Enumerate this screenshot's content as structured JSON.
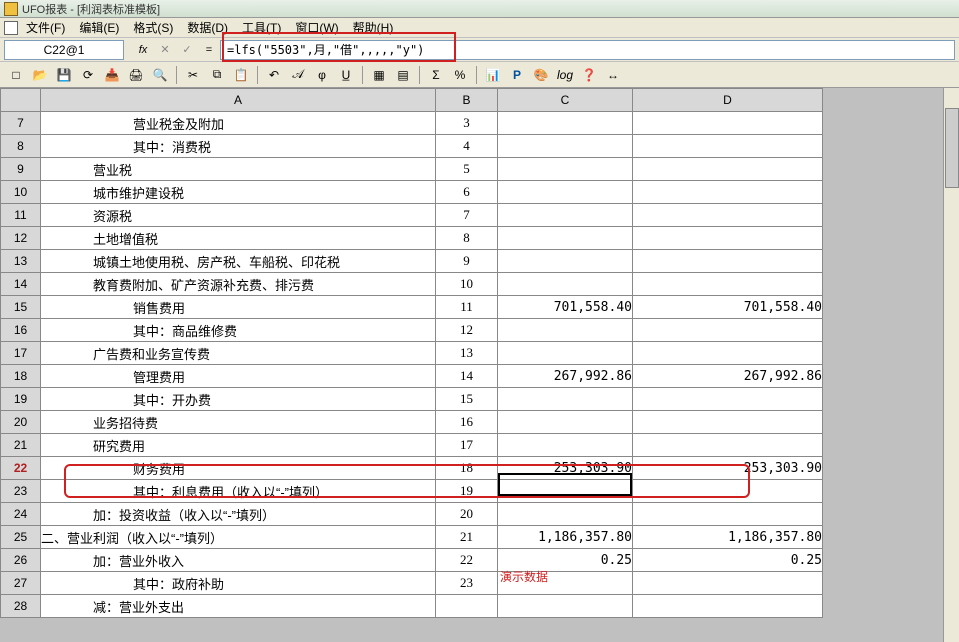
{
  "title": "UFO报表 - [利润表标准模板]",
  "menu": {
    "file": "文件(F)",
    "edit": "编辑(E)",
    "format": "格式(S)",
    "data": "数据(D)",
    "tool": "工具(T)",
    "window": "窗口(W)",
    "help": "帮助(H)"
  },
  "cell_ref": "C22@1",
  "formula": "=lfs(\"5503\",月,\"借\",,,,,\"y\")",
  "fb": {
    "fx": "fx",
    "x": "✕",
    "check": "✓",
    "eq": "="
  },
  "tb": {
    "new": "□",
    "open": "📂",
    "save": "💾",
    "refresh": "⟳",
    "import": "📥",
    "print": "🖨",
    "preview": "🔍",
    "cut": "✂",
    "copy": "⧉",
    "paste": "📋",
    "undo": "↶",
    "script": "𝒜",
    "phi": "φ",
    "ul": "U̲",
    "grid1": "▦",
    "grid2": "▤",
    "sigma": "Σ",
    "pct": "%",
    "chart": "📊",
    "bold": "P",
    "color": "🎨",
    "log": "log",
    "help": "❓",
    "arrow": "↔"
  },
  "cols": {
    "a": "A",
    "b": "B",
    "c": "C",
    "d": "D"
  },
  "rows": [
    {
      "n": 7,
      "a": "营业税金及附加",
      "cls": "indent2",
      "b": "3",
      "c": "",
      "d": ""
    },
    {
      "n": 8,
      "a": "其中：消费税",
      "cls": "indent2",
      "b": "4",
      "c": "",
      "d": ""
    },
    {
      "n": 9,
      "a": "营业税",
      "cls": "indent3",
      "b": "5",
      "c": "",
      "d": ""
    },
    {
      "n": 10,
      "a": "城市维护建设税",
      "cls": "indent3",
      "b": "6",
      "c": "",
      "d": ""
    },
    {
      "n": 11,
      "a": "资源税",
      "cls": "indent3",
      "b": "7",
      "c": "",
      "d": ""
    },
    {
      "n": 12,
      "a": "土地增值税",
      "cls": "indent3",
      "b": "8",
      "c": "",
      "d": ""
    },
    {
      "n": 13,
      "a": "城镇土地使用税、房产税、车船税、印花税",
      "cls": "indent3",
      "b": "9",
      "c": "",
      "d": ""
    },
    {
      "n": 14,
      "a": "教育费附加、矿产资源补充费、排污费",
      "cls": "indent3",
      "b": "10",
      "c": "",
      "d": ""
    },
    {
      "n": 15,
      "a": "销售费用",
      "cls": "indent2",
      "b": "11",
      "c": "701,558.40",
      "d": "701,558.40"
    },
    {
      "n": 16,
      "a": "其中：商品维修费",
      "cls": "indent2",
      "b": "12",
      "c": "",
      "d": ""
    },
    {
      "n": 17,
      "a": "广告费和业务宣传费",
      "cls": "indent3",
      "b": "13",
      "c": "",
      "d": ""
    },
    {
      "n": 18,
      "a": "管理费用",
      "cls": "indent2",
      "b": "14",
      "c": "267,992.86",
      "d": "267,992.86"
    },
    {
      "n": 19,
      "a": "其中：开办费",
      "cls": "indent2",
      "b": "15",
      "c": "",
      "d": ""
    },
    {
      "n": 20,
      "a": "业务招待费",
      "cls": "indent3",
      "b": "16",
      "c": "",
      "d": ""
    },
    {
      "n": 21,
      "a": "研究费用",
      "cls": "indent3",
      "b": "17",
      "c": "",
      "d": ""
    },
    {
      "n": 22,
      "a": "财务费用",
      "cls": "indent2",
      "b": "18",
      "c": "253,303.90",
      "d": "253,303.90",
      "sel": true
    },
    {
      "n": 23,
      "a": "其中：利息费用（收入以“-”填列）",
      "cls": "indent2",
      "b": "19",
      "c": "",
      "d": ""
    },
    {
      "n": 24,
      "a": "加：投资收益（收入以“-”填列）",
      "cls": "indent1",
      "b": "20",
      "c": "",
      "d": ""
    },
    {
      "n": 25,
      "a": "二、营业利润（收入以“-”填列）",
      "cls": "",
      "b": "21",
      "c": "1,186,357.80",
      "d": "1,186,357.80"
    },
    {
      "n": 26,
      "a": "加：营业外收入",
      "cls": "indent1",
      "b": "22",
      "c": "0.25",
      "d": "0.25"
    },
    {
      "n": 27,
      "a": "其中：政府补助",
      "cls": "indent2",
      "b": "23",
      "c": "",
      "d": ""
    },
    {
      "n": 28,
      "a": "减：营业外支出",
      "cls": "indent1",
      "b": "",
      "c": "",
      "d": ""
    }
  ],
  "demo_label": "演示数据"
}
